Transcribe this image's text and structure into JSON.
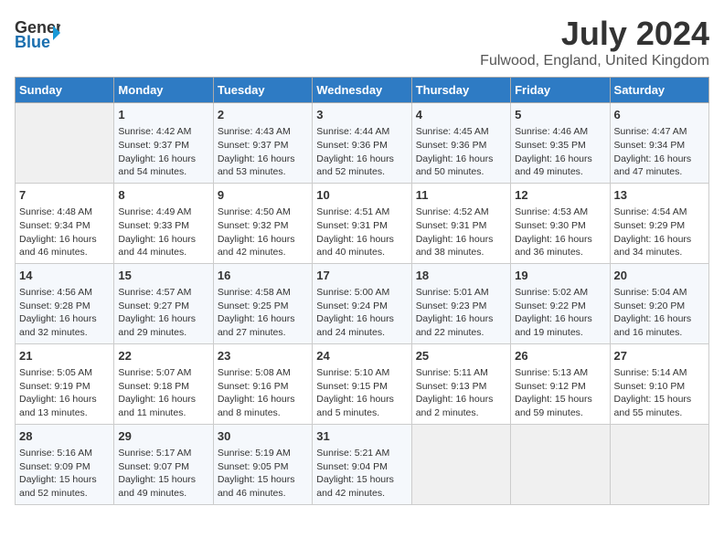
{
  "header": {
    "logo_line1": "General",
    "logo_line2": "Blue",
    "title": "July 2024",
    "subtitle": "Fulwood, England, United Kingdom"
  },
  "days_of_week": [
    "Sunday",
    "Monday",
    "Tuesday",
    "Wednesday",
    "Thursday",
    "Friday",
    "Saturday"
  ],
  "weeks": [
    [
      {
        "day": "",
        "content": ""
      },
      {
        "day": "1",
        "content": "Sunrise: 4:42 AM\nSunset: 9:37 PM\nDaylight: 16 hours\nand 54 minutes."
      },
      {
        "day": "2",
        "content": "Sunrise: 4:43 AM\nSunset: 9:37 PM\nDaylight: 16 hours\nand 53 minutes."
      },
      {
        "day": "3",
        "content": "Sunrise: 4:44 AM\nSunset: 9:36 PM\nDaylight: 16 hours\nand 52 minutes."
      },
      {
        "day": "4",
        "content": "Sunrise: 4:45 AM\nSunset: 9:36 PM\nDaylight: 16 hours\nand 50 minutes."
      },
      {
        "day": "5",
        "content": "Sunrise: 4:46 AM\nSunset: 9:35 PM\nDaylight: 16 hours\nand 49 minutes."
      },
      {
        "day": "6",
        "content": "Sunrise: 4:47 AM\nSunset: 9:34 PM\nDaylight: 16 hours\nand 47 minutes."
      }
    ],
    [
      {
        "day": "7",
        "content": "Sunrise: 4:48 AM\nSunset: 9:34 PM\nDaylight: 16 hours\nand 46 minutes."
      },
      {
        "day": "8",
        "content": "Sunrise: 4:49 AM\nSunset: 9:33 PM\nDaylight: 16 hours\nand 44 minutes."
      },
      {
        "day": "9",
        "content": "Sunrise: 4:50 AM\nSunset: 9:32 PM\nDaylight: 16 hours\nand 42 minutes."
      },
      {
        "day": "10",
        "content": "Sunrise: 4:51 AM\nSunset: 9:31 PM\nDaylight: 16 hours\nand 40 minutes."
      },
      {
        "day": "11",
        "content": "Sunrise: 4:52 AM\nSunset: 9:31 PM\nDaylight: 16 hours\nand 38 minutes."
      },
      {
        "day": "12",
        "content": "Sunrise: 4:53 AM\nSunset: 9:30 PM\nDaylight: 16 hours\nand 36 minutes."
      },
      {
        "day": "13",
        "content": "Sunrise: 4:54 AM\nSunset: 9:29 PM\nDaylight: 16 hours\nand 34 minutes."
      }
    ],
    [
      {
        "day": "14",
        "content": "Sunrise: 4:56 AM\nSunset: 9:28 PM\nDaylight: 16 hours\nand 32 minutes."
      },
      {
        "day": "15",
        "content": "Sunrise: 4:57 AM\nSunset: 9:27 PM\nDaylight: 16 hours\nand 29 minutes."
      },
      {
        "day": "16",
        "content": "Sunrise: 4:58 AM\nSunset: 9:25 PM\nDaylight: 16 hours\nand 27 minutes."
      },
      {
        "day": "17",
        "content": "Sunrise: 5:00 AM\nSunset: 9:24 PM\nDaylight: 16 hours\nand 24 minutes."
      },
      {
        "day": "18",
        "content": "Sunrise: 5:01 AM\nSunset: 9:23 PM\nDaylight: 16 hours\nand 22 minutes."
      },
      {
        "day": "19",
        "content": "Sunrise: 5:02 AM\nSunset: 9:22 PM\nDaylight: 16 hours\nand 19 minutes."
      },
      {
        "day": "20",
        "content": "Sunrise: 5:04 AM\nSunset: 9:20 PM\nDaylight: 16 hours\nand 16 minutes."
      }
    ],
    [
      {
        "day": "21",
        "content": "Sunrise: 5:05 AM\nSunset: 9:19 PM\nDaylight: 16 hours\nand 13 minutes."
      },
      {
        "day": "22",
        "content": "Sunrise: 5:07 AM\nSunset: 9:18 PM\nDaylight: 16 hours\nand 11 minutes."
      },
      {
        "day": "23",
        "content": "Sunrise: 5:08 AM\nSunset: 9:16 PM\nDaylight: 16 hours\nand 8 minutes."
      },
      {
        "day": "24",
        "content": "Sunrise: 5:10 AM\nSunset: 9:15 PM\nDaylight: 16 hours\nand 5 minutes."
      },
      {
        "day": "25",
        "content": "Sunrise: 5:11 AM\nSunset: 9:13 PM\nDaylight: 16 hours\nand 2 minutes."
      },
      {
        "day": "26",
        "content": "Sunrise: 5:13 AM\nSunset: 9:12 PM\nDaylight: 15 hours\nand 59 minutes."
      },
      {
        "day": "27",
        "content": "Sunrise: 5:14 AM\nSunset: 9:10 PM\nDaylight: 15 hours\nand 55 minutes."
      }
    ],
    [
      {
        "day": "28",
        "content": "Sunrise: 5:16 AM\nSunset: 9:09 PM\nDaylight: 15 hours\nand 52 minutes."
      },
      {
        "day": "29",
        "content": "Sunrise: 5:17 AM\nSunset: 9:07 PM\nDaylight: 15 hours\nand 49 minutes."
      },
      {
        "day": "30",
        "content": "Sunrise: 5:19 AM\nSunset: 9:05 PM\nDaylight: 15 hours\nand 46 minutes."
      },
      {
        "day": "31",
        "content": "Sunrise: 5:21 AM\nSunset: 9:04 PM\nDaylight: 15 hours\nand 42 minutes."
      },
      {
        "day": "",
        "content": ""
      },
      {
        "day": "",
        "content": ""
      },
      {
        "day": "",
        "content": ""
      }
    ]
  ]
}
